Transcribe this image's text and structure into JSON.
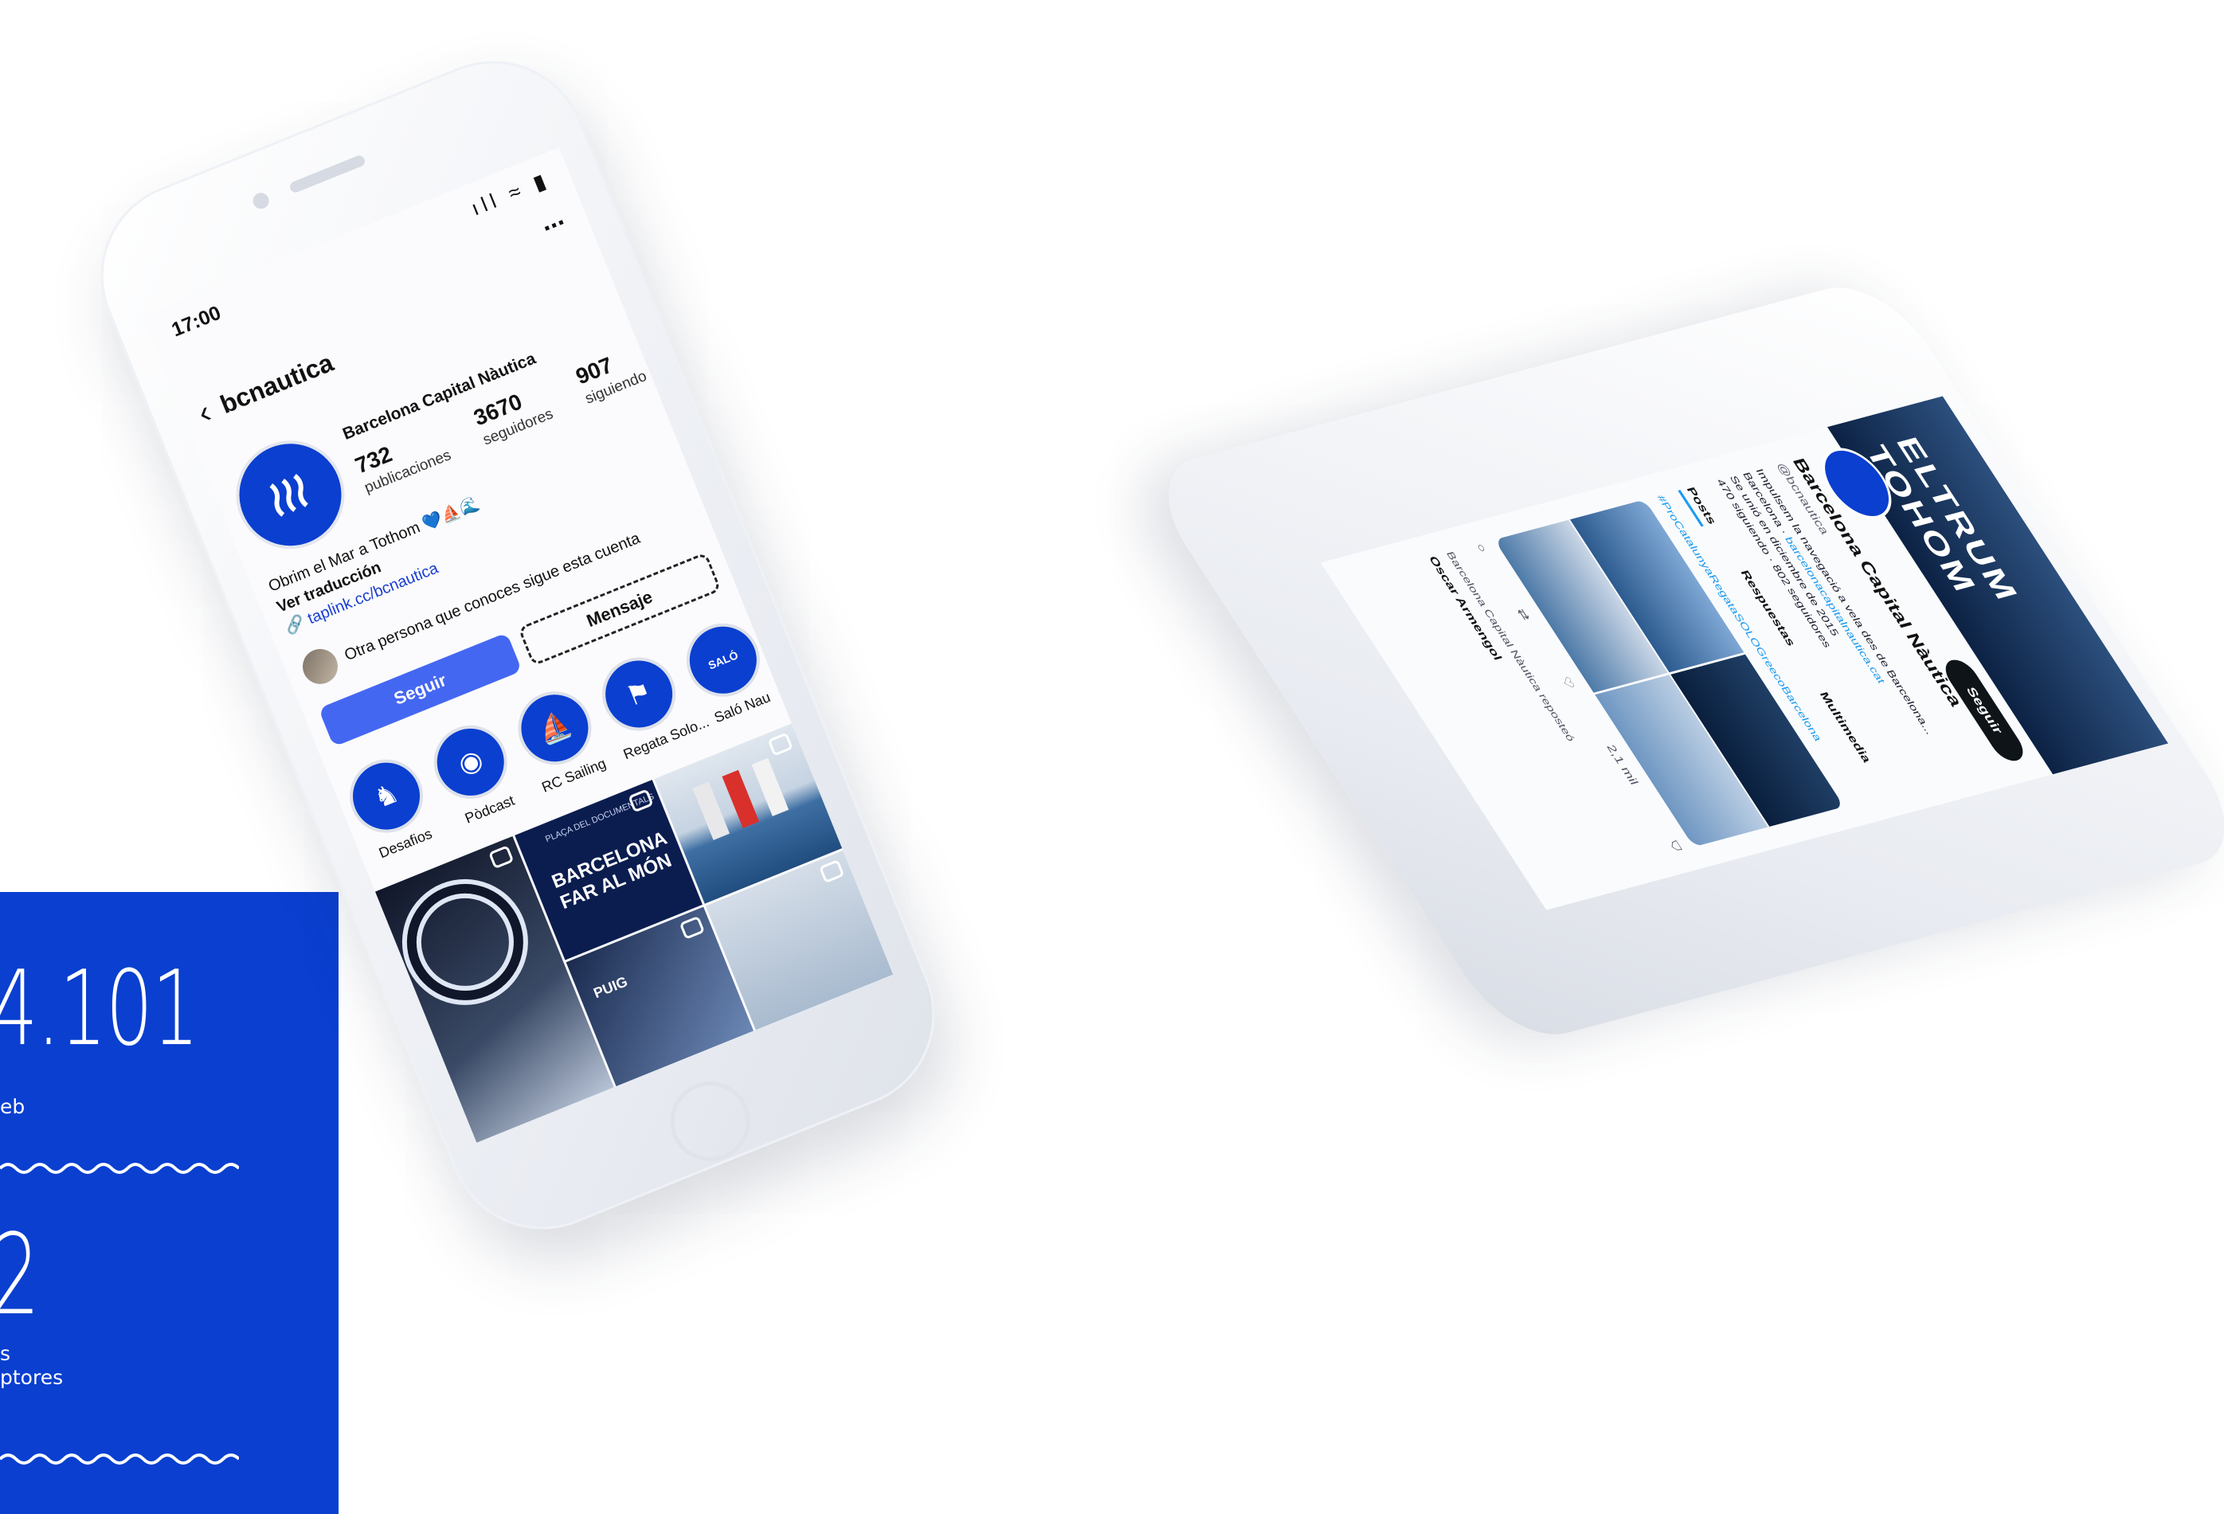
{
  "stats_panel": {
    "stat1_value": "4.101",
    "stat1_label": "eb",
    "stat2_value": "2",
    "stat2_label_line1": "s",
    "stat2_label_line2": "ptores",
    "accent": "#0a3fd0"
  },
  "instagram": {
    "time": "17:00",
    "status_icons": "ıll ≈ ▮",
    "more": "...",
    "back_icon": "‹",
    "handle": "bcnautica",
    "display_name": "Barcelona Capital Nàutica",
    "posts_count": "732",
    "posts_label": "publicaciones",
    "followers_count": "3670",
    "followers_label": "seguidores",
    "following_count": "907",
    "following_label": "siguiendo",
    "bio": "Obrim el Mar a Tothom 💙⛵🌊",
    "translate": "Ver traducción",
    "link": "taplink.cc/bcnautica",
    "mutual": "Otra persona que conoces sigue esta cuenta",
    "follow_button": "Seguir",
    "message_button": "Mensaje",
    "highlights": [
      {
        "label": "Desafios",
        "icon": "seahorse-icon",
        "glyph": "♞"
      },
      {
        "label": "Pòdcast",
        "icon": "podcast-icon",
        "glyph": "◉"
      },
      {
        "label": "RC Sailing",
        "icon": "sailing-icon",
        "glyph": "⛵"
      },
      {
        "label": "Regata Solo...",
        "icon": "regatta-icon",
        "glyph": "⚑"
      },
      {
        "label": "Saló Nau",
        "icon": "salo-icon",
        "glyph": "SALÓ"
      }
    ],
    "grid": {
      "tile2_small": "PLAÇA DEL DOCUMENTALS",
      "tile2_title": "BARCELONA FAR AL MÓN",
      "tile4_text": "PUIG"
    },
    "brand_color": "#4467f2"
  },
  "twitter": {
    "banner_text": "ELTRUM TOHOM",
    "display_name": "Barcelona Capital Nàutica",
    "handle": "@bcnautica",
    "follow_button": "Seguir",
    "bio": "Impulsem la navegació a vela des de Barcelona...",
    "location": "Barcelona",
    "website": "barcelonacapitalnautica.cat",
    "joined": "Se unió en diciembre de 2015",
    "following": "470 siguiendo",
    "followers": "802 seguidores",
    "tabs": [
      "Posts",
      "Respuestas",
      "Multimedia"
    ],
    "hashtag_line": "#ProCatalunyaRegataSOLOGreecoBarcelona",
    "actions": [
      "○",
      "⇄",
      "♡",
      "2,1 mil",
      "⛉"
    ],
    "retweet_line": "Barcelona Capital Nàutica reposteó",
    "author": "Oscar Armengol",
    "accent": "#1d9bf0"
  }
}
